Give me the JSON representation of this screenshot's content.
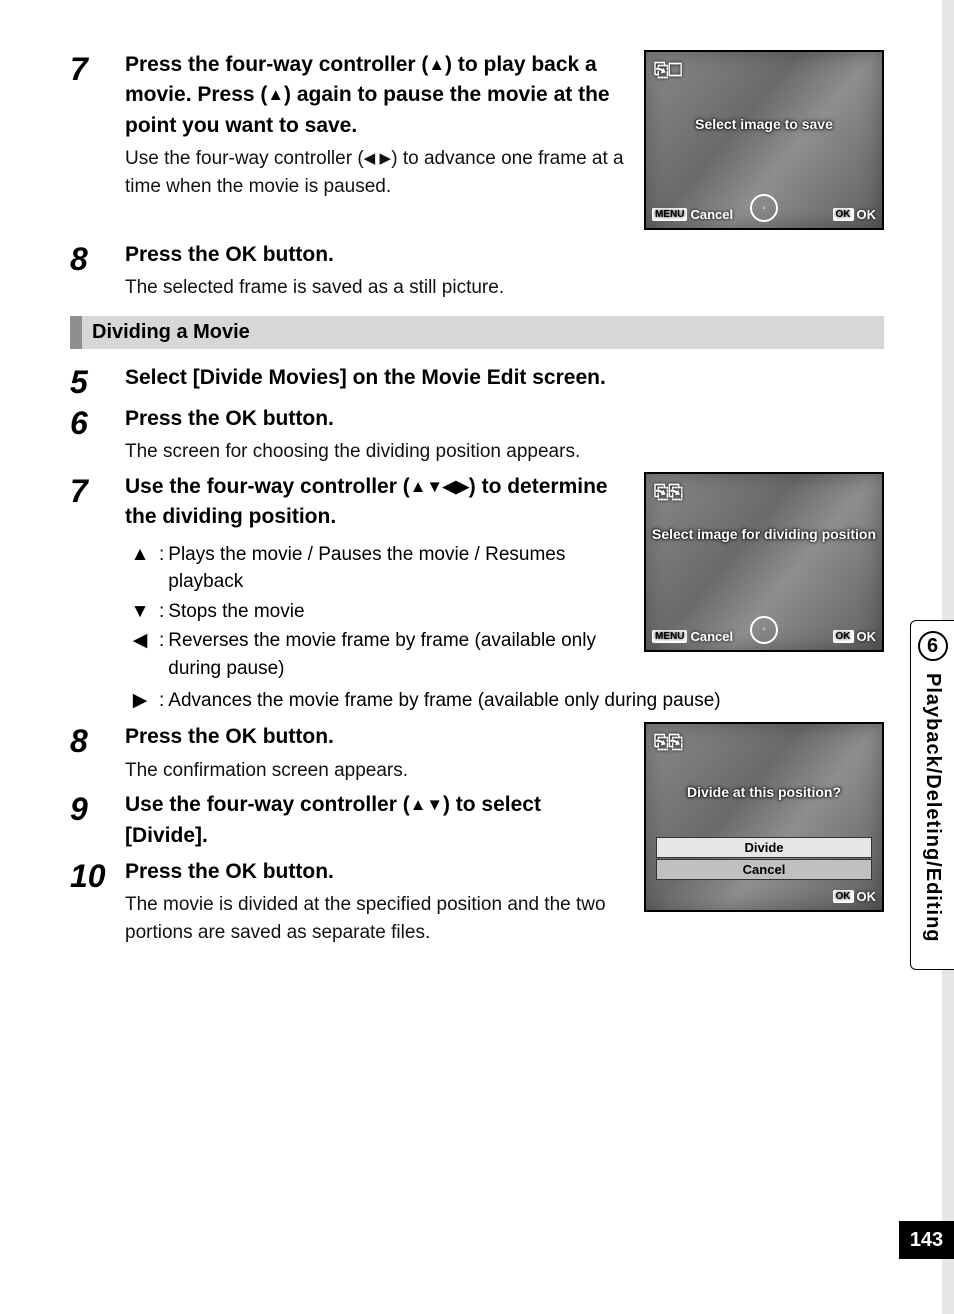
{
  "side": {
    "chapter_num": "6",
    "chapter_title": "Playback/Deleting/Editing",
    "page_num": "143"
  },
  "section1": {
    "step7": {
      "num": "7",
      "title_a": "Press the four-way controller (",
      "title_b": ") to play back a movie. Press (",
      "title_c": ") again to pause the movie at the point you want to save.",
      "desc_a": "Use the four-way controller (",
      "desc_b": ") to advance one frame at a time when the movie is paused."
    },
    "step8": {
      "num": "8",
      "title": "Press the OK button.",
      "desc": "The selected frame is saved as a still picture."
    },
    "screenshot1": {
      "icon": "⎘☐",
      "caption": "Select image to save",
      "menu": "MENU",
      "cancel": "Cancel",
      "ok_badge": "OK",
      "ok": "OK"
    }
  },
  "section_header": "Dividing a Movie",
  "section2": {
    "step5": {
      "num": "5",
      "title": "Select [Divide Movies] on the Movie Edit screen."
    },
    "step6": {
      "num": "6",
      "title": "Press the OK button.",
      "desc": "The screen for choosing the dividing position appears."
    },
    "step7": {
      "num": "7",
      "title_a": "Use the four-way controller (",
      "title_b": ") to determine the dividing position.",
      "rows": {
        "up": "Plays the movie / Pauses the movie / Resumes playback",
        "down": "Stops the movie",
        "left": "Reverses the movie frame by frame (available only during pause)",
        "right": "Advances the movie frame by frame (available only during pause)"
      }
    },
    "step8": {
      "num": "8",
      "title": "Press the OK button.",
      "desc": "The confirmation screen appears."
    },
    "step9": {
      "num": "9",
      "title_a": "Use the four-way controller (",
      "title_b": ") to select [Divide]."
    },
    "step10": {
      "num": "10",
      "title": "Press the OK button.",
      "desc": "The movie is divided at the specified position and the two portions are saved as separate files."
    },
    "screenshot2": {
      "caption": "Select image for dividing position",
      "menu": "MENU",
      "cancel": "Cancel",
      "ok_badge": "OK",
      "ok": "OK"
    },
    "screenshot3": {
      "caption": "Divide at this position?",
      "opt_divide": "Divide",
      "opt_cancel": "Cancel",
      "ok_badge": "OK",
      "ok": "OK"
    }
  },
  "glyphs": {
    "up": "▲",
    "down": "▼",
    "left": "◀",
    "right": "▶",
    "left_right": "◀ ▶",
    "all4": "▲▼◀▶",
    "up_down": "▲▼"
  }
}
